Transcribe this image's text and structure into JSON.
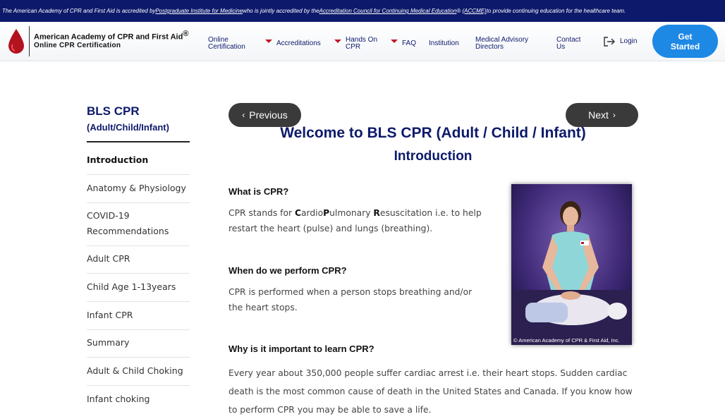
{
  "banner": {
    "text_1": "The American Academy of CPR and First Aid is accredited by ",
    "link_1": "Postgraduate Institute for Medicine",
    "text_2": " who is jointly accredited by the ",
    "link_2": "Accreditation Council for Continuing Medical Education",
    "reg": "®",
    "link_3": "(ACCME)",
    "text_3": " to provide continuing education for the healthcare team."
  },
  "header": {
    "brand_name": "American Academy of CPR and First Aid",
    "brand_reg": "®",
    "brand_sub": "Online CPR Certification",
    "nav": {
      "online_certification": "Online Certification",
      "accreditations": "Accreditations",
      "hands_on_cpr": "Hands On CPR",
      "faq": "FAQ",
      "institution": "Institution",
      "medical_advisory": "Medical Advisory Directors",
      "contact_us": "Contact Us",
      "login": "Login",
      "get_started": "Get Started"
    }
  },
  "sidebar": {
    "title": "BLS CPR",
    "subtitle": "(Adult/Child/Infant)",
    "items": [
      "Introduction",
      "Anatomy & Physiology",
      "COVID-19 Recommendations",
      "Adult CPR",
      "Child Age 1-13years",
      "Infant CPR",
      "Summary",
      "Adult & Child Choking",
      "Infant choking"
    ]
  },
  "main": {
    "previous": "Previous",
    "next": "Next",
    "title": "Welcome to BLS CPR (Adult / Child / Infant)",
    "subtitle": "Introduction",
    "q1": "What is CPR?",
    "a1_pre": "CPR stands for ",
    "a1_c": "C",
    "a1_ardio": "ardio",
    "a1_p": "P",
    "a1_ulmonary": "ulmonary ",
    "a1_r": "R",
    "a1_post": "esuscitation i.e. to help restart the heart (pulse) and lungs (breathing).",
    "q2": "When do we perform CPR?",
    "a2": "CPR is performed when a person stops breathing and/or the heart stops.",
    "q3": "Why is it important to learn CPR?",
    "a3": "Every year about 350,000 people suffer cardiac arrest i.e. their heart stops. Sudden cardiac death is the most common cause of death in the United States and Canada. If you know how to perform CPR you may be able to save a life.",
    "photo_caption": "© American Academy of CPR & First Aid, Inc."
  },
  "colors": {
    "navy": "#0d1a6b",
    "accent_red": "#c0192c",
    "button_blue": "#1e88e5",
    "pill_dark": "#3a3a3a"
  }
}
